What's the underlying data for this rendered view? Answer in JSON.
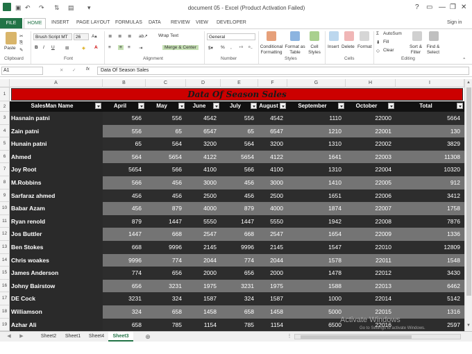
{
  "window": {
    "title": "document 05 - Excel (Product Activation Failed)",
    "user": "Sign in"
  },
  "ribbon_tabs": [
    "FILE",
    "HOME",
    "INSERT",
    "PAGE LAYOUT",
    "FORMULAS",
    "DATA",
    "REVIEW",
    "VIEW",
    "DEVELOPER"
  ],
  "ribbon": {
    "paste": "Paste",
    "clipboard": "Clipboard",
    "font_name": "Brush Script MT",
    "font_size": "26",
    "font": "Font",
    "wrap_text": "Wrap Text",
    "merge_center": "Merge & Center",
    "alignment": "Alignment",
    "number_format": "General",
    "number": "Number",
    "conditional_formatting": "Conditional Formatting",
    "format_as_table": "Format as Table",
    "cell_styles": "Cell Styles",
    "styles": "Styles",
    "insert": "Insert",
    "delete": "Delete",
    "format": "Format",
    "cells": "Cells",
    "autosum": "AutoSum",
    "fill": "Fill",
    "clear": "Clear",
    "sort_filter": "Sort & Filter",
    "find_select": "Find & Select",
    "editing": "Editing",
    "bold": "B",
    "italic": "I",
    "underline": "U",
    "font_color_glyph": "A",
    "percent": "%",
    "comma": ","
  },
  "formula_bar": {
    "cell_ref": "A1",
    "fx": "fx",
    "content": "Data Of Season Sales"
  },
  "columns": [
    "A",
    "B",
    "C",
    "D",
    "E",
    "F",
    "G",
    "H",
    "I"
  ],
  "sheet": {
    "title": "Data Of Season Sales",
    "headers": [
      "SalesMan Name",
      "April",
      "May",
      "June",
      "July",
      "August",
      "September",
      "October",
      "Total"
    ],
    "rows": [
      [
        "Hasnain patni",
        "566",
        "556",
        "4542",
        "556",
        "4542",
        "1110",
        "22000",
        "5664"
      ],
      [
        "Zain patni",
        "556",
        "65",
        "6547",
        "65",
        "6547",
        "1210",
        "22001",
        "130"
      ],
      [
        "Hunain patni",
        "65",
        "564",
        "3200",
        "564",
        "3200",
        "1310",
        "22002",
        "3829"
      ],
      [
        "Ahmed",
        "564",
        "5654",
        "4122",
        "5654",
        "4122",
        "1641",
        "22003",
        "11308"
      ],
      [
        "Joy Root",
        "5654",
        "566",
        "4100",
        "566",
        "4100",
        "1310",
        "22004",
        "10320"
      ],
      [
        "M.Robbins",
        "566",
        "456",
        "3000",
        "456",
        "3000",
        "1410",
        "22005",
        "912"
      ],
      [
        "Sarfaraz ahmed",
        "456",
        "456",
        "2500",
        "456",
        "2500",
        "1651",
        "22006",
        "3412"
      ],
      [
        "Babar Azam",
        "456",
        "879",
        "4000",
        "879",
        "4000",
        "1874",
        "22007",
        "1758"
      ],
      [
        "Ryan renold",
        "879",
        "1447",
        "5550",
        "1447",
        "5550",
        "1942",
        "22008",
        "7876"
      ],
      [
        "Jos Buttler",
        "1447",
        "668",
        "2547",
        "668",
        "2547",
        "1654",
        "22009",
        "1336"
      ],
      [
        "Ben Stokes",
        "668",
        "9996",
        "2145",
        "9996",
        "2145",
        "1547",
        "22010",
        "12809"
      ],
      [
        "Chris woakes",
        "9996",
        "774",
        "2044",
        "774",
        "2044",
        "1578",
        "22011",
        "1548"
      ],
      [
        "James Anderson",
        "774",
        "656",
        "2000",
        "656",
        "2000",
        "1478",
        "22012",
        "3430"
      ],
      [
        "Johny Bairstow",
        "656",
        "3231",
        "1975",
        "3231",
        "1975",
        "1588",
        "22013",
        "6462"
      ],
      [
        "DE Cock",
        "3231",
        "324",
        "1587",
        "324",
        "1587",
        "1000",
        "22014",
        "5142"
      ],
      [
        "Williamson",
        "324",
        "658",
        "1458",
        "658",
        "1458",
        "5000",
        "22015",
        "1316"
      ],
      [
        "Azhar Ali",
        "658",
        "785",
        "1154",
        "785",
        "1154",
        "6500",
        "22016",
        "2597"
      ]
    ],
    "row_numbers": [
      "1",
      "2",
      "3",
      "4",
      "5",
      "6",
      "7",
      "8",
      "9",
      "10",
      "11",
      "12",
      "13",
      "14",
      "15",
      "16",
      "17",
      "18",
      "19"
    ]
  },
  "sheet_tabs": [
    "Sheet2",
    "Sheet1",
    "Sheet4",
    "Sheet3"
  ],
  "active_sheet": "Sheet3",
  "watermark": {
    "line1": "Activate Windows",
    "line2": "Go to Settings to activate Windows."
  },
  "colors": {
    "title_red": "#cc0000",
    "title_text": "#1a1a1a",
    "excel_green": "#217346",
    "row_dark": "#2d2d2d",
    "row_light": "#747474",
    "name_col": "#2a2a2a"
  }
}
